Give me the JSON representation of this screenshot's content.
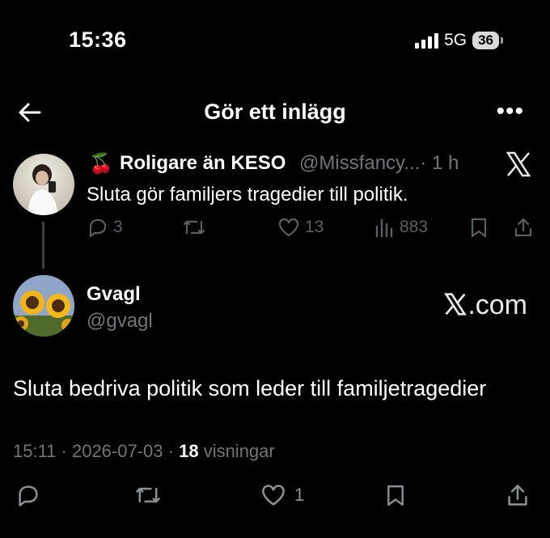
{
  "status_bar": {
    "time": "15:36",
    "network": "5G",
    "battery": "36"
  },
  "header": {
    "title": "Gör ett inlägg",
    "back_icon": "arrow-left-icon",
    "more_icon": "more-icon"
  },
  "quoted_post": {
    "emoji": "🍒",
    "display_name": "Roligare än KESO",
    "handle": "@Missfancy...",
    "time": "· 1 h",
    "text": "Sluta gör familjers tragedier till politik.",
    "replies": "3",
    "likes": "13",
    "views": "883"
  },
  "post": {
    "display_name": "Gvagl",
    "handle": "@gvagl",
    "text": "Sluta bedriva politik som leder till familjetragedier",
    "time": "15:11 · 2026-07-03 ·",
    "views_count": "18",
    "views_label": "visningar",
    "likes": "1"
  },
  "watermark": {
    "text": ".com"
  }
}
